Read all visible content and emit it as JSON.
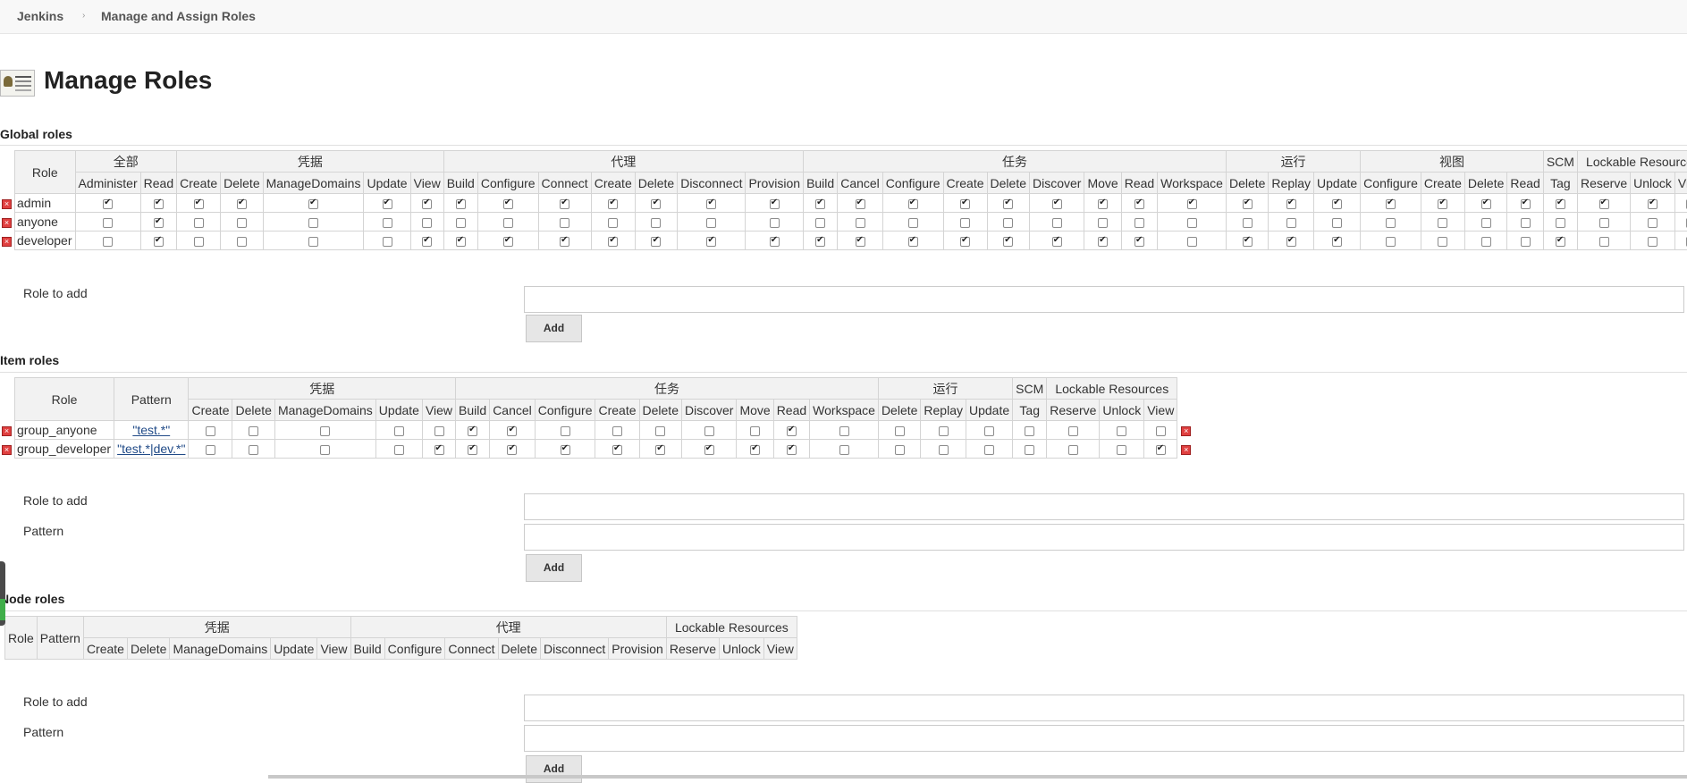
{
  "breadcrumb": {
    "root": "Jenkins",
    "current": "Manage and Assign Roles"
  },
  "page": {
    "title": "Manage Roles"
  },
  "global": {
    "heading": "Global roles",
    "role_header": "Role",
    "groups": [
      {
        "label": "全部",
        "span": 2
      },
      {
        "label": "凭据",
        "span": 5
      },
      {
        "label": "代理",
        "span": 7
      },
      {
        "label": "任务",
        "span": 9
      },
      {
        "label": "运行",
        "span": 3
      },
      {
        "label": "视图",
        "span": 4
      },
      {
        "label": "SCM",
        "span": 1
      },
      {
        "label": "Lockable Resources",
        "span": 3
      }
    ],
    "columns": [
      "Administer",
      "Read",
      "Create",
      "Delete",
      "ManageDomains",
      "Update",
      "View",
      "Build",
      "Configure",
      "Connect",
      "Create",
      "Delete",
      "Disconnect",
      "Provision",
      "Build",
      "Cancel",
      "Configure",
      "Create",
      "Delete",
      "Discover",
      "Move",
      "Read",
      "Workspace",
      "Delete",
      "Replay",
      "Update",
      "Configure",
      "Create",
      "Delete",
      "Read",
      "Tag",
      "Reserve",
      "Unlock",
      "View"
    ],
    "rows": [
      {
        "name": "admin",
        "checks": [
          1,
          1,
          1,
          1,
          1,
          1,
          1,
          1,
          1,
          1,
          1,
          1,
          1,
          1,
          1,
          1,
          1,
          1,
          1,
          1,
          1,
          1,
          1,
          1,
          1,
          1,
          1,
          1,
          1,
          1,
          1,
          1,
          1,
          1
        ]
      },
      {
        "name": "anyone",
        "checks": [
          0,
          1,
          0,
          0,
          0,
          0,
          0,
          0,
          0,
          0,
          0,
          0,
          0,
          0,
          0,
          0,
          0,
          0,
          0,
          0,
          0,
          0,
          0,
          0,
          0,
          0,
          0,
          0,
          0,
          0,
          0,
          0,
          0,
          0
        ]
      },
      {
        "name": "developer",
        "checks": [
          0,
          1,
          0,
          0,
          0,
          0,
          1,
          1,
          1,
          1,
          1,
          1,
          1,
          1,
          1,
          1,
          1,
          1,
          1,
          1,
          1,
          1,
          0,
          1,
          1,
          1,
          0,
          0,
          0,
          0,
          1,
          0,
          0,
          1
        ]
      }
    ],
    "form": {
      "role_label": "Role to add",
      "add_label": "Add"
    }
  },
  "item": {
    "heading": "Item roles",
    "role_header": "Role",
    "pattern_header": "Pattern",
    "groups": [
      {
        "label": "凭据",
        "span": 5
      },
      {
        "label": "任务",
        "span": 9
      },
      {
        "label": "运行",
        "span": 3
      },
      {
        "label": "SCM",
        "span": 1
      },
      {
        "label": "Lockable Resources",
        "span": 3
      }
    ],
    "columns": [
      "Create",
      "Delete",
      "ManageDomains",
      "Update",
      "View",
      "Build",
      "Cancel",
      "Configure",
      "Create",
      "Delete",
      "Discover",
      "Move",
      "Read",
      "Workspace",
      "Delete",
      "Replay",
      "Update",
      "Tag",
      "Reserve",
      "Unlock",
      "View"
    ],
    "rows": [
      {
        "name": "group_anyone",
        "pattern": "\"test.*\"",
        "checks": [
          0,
          0,
          0,
          0,
          0,
          1,
          1,
          0,
          0,
          0,
          0,
          0,
          1,
          0,
          0,
          0,
          0,
          0,
          0,
          0,
          0
        ]
      },
      {
        "name": "group_developer",
        "pattern": "\"test.*|dev.*\"",
        "checks": [
          0,
          0,
          0,
          0,
          1,
          1,
          1,
          1,
          1,
          1,
          1,
          1,
          1,
          0,
          0,
          0,
          0,
          0,
          0,
          0,
          1
        ]
      }
    ],
    "form": {
      "role_label": "Role to add",
      "pattern_label": "Pattern",
      "add_label": "Add"
    }
  },
  "node": {
    "heading": "Node roles",
    "role_header": "Role",
    "pattern_header": "Pattern",
    "groups": [
      {
        "label": "凭据",
        "span": 5
      },
      {
        "label": "代理",
        "span": 6
      },
      {
        "label": "Lockable Resources",
        "span": 3
      }
    ],
    "columns": [
      "Create",
      "Delete",
      "ManageDomains",
      "Update",
      "View",
      "Build",
      "Configure",
      "Connect",
      "Delete",
      "Disconnect",
      "Provision",
      "Reserve",
      "Unlock",
      "View"
    ],
    "rows": [],
    "form": {
      "role_label": "Role to add",
      "pattern_label": "Pattern",
      "add_label": "Add"
    }
  }
}
